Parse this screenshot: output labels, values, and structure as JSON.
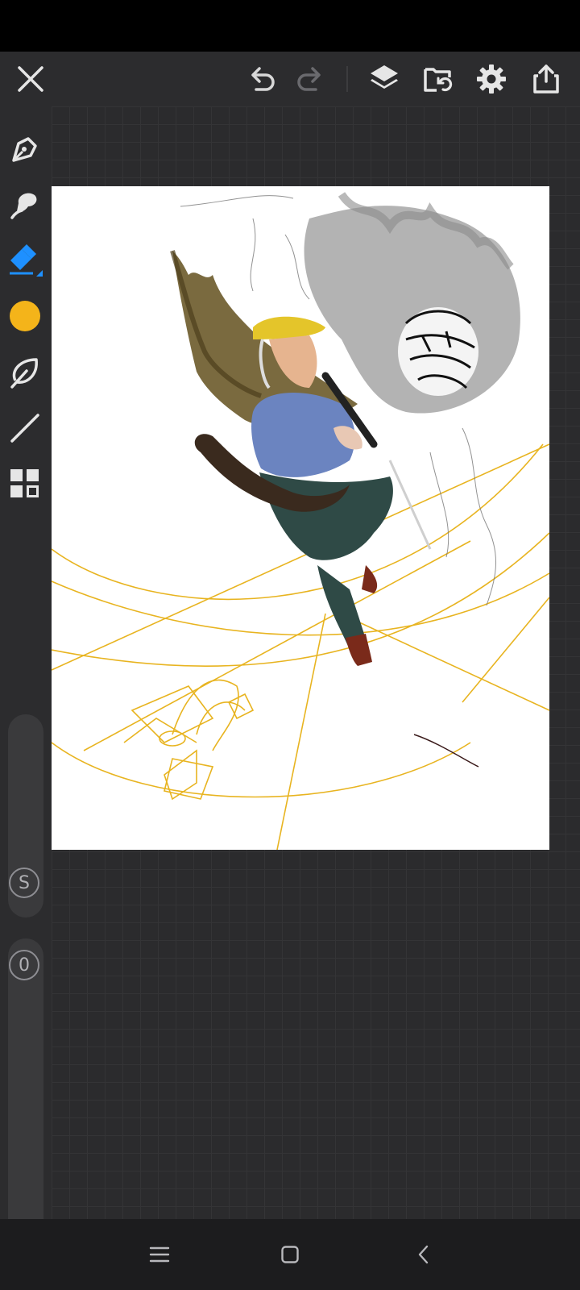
{
  "app": {
    "accent_color": "#1e90ff",
    "current_color": "#f4b41a"
  },
  "toolbar": {
    "icons": [
      "close-icon",
      "undo-icon",
      "redo-icon",
      "layers-icon",
      "import-icon",
      "settings-icon",
      "share-icon"
    ]
  },
  "tools": [
    "pen-icon",
    "smudge-icon",
    "eraser-icon",
    "color-swatch",
    "lasso-icon",
    "line-icon",
    "grid-menu-icon"
  ],
  "sliders": {
    "size_label": "S",
    "opacity_label": "0"
  },
  "nav": {
    "icons": [
      "menu-icon",
      "home-icon",
      "back-icon"
    ]
  }
}
